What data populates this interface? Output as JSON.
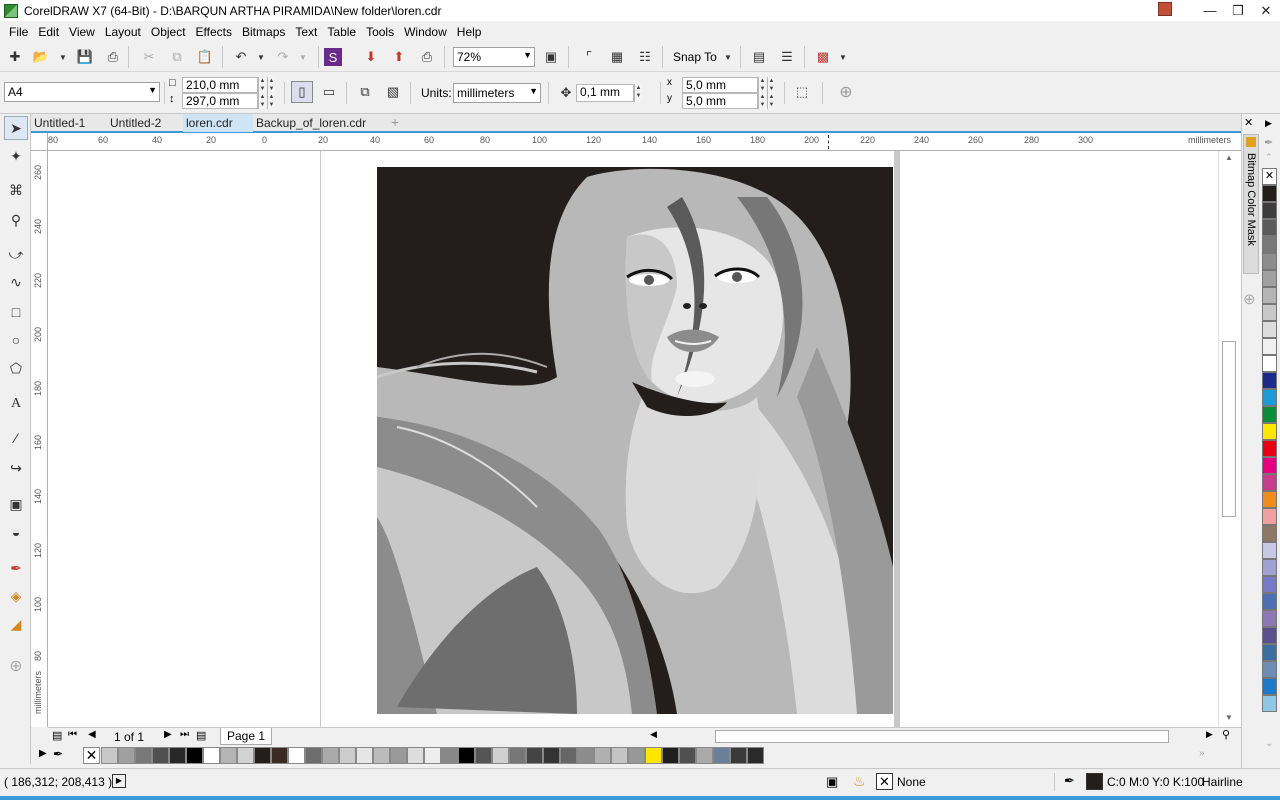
{
  "window": {
    "title": "CorelDRAW X7 (64-Bit) - D:\\BARQUN ARTHA PIRAMIDA\\New folder\\loren.cdr"
  },
  "menu": [
    "File",
    "Edit",
    "View",
    "Layout",
    "Object",
    "Effects",
    "Bitmaps",
    "Text",
    "Table",
    "Tools",
    "Window",
    "Help"
  ],
  "toolbar": {
    "zoom": "72%",
    "snap_to": "Snap To"
  },
  "property_bar": {
    "page_size": "A4",
    "width": "210,0 mm",
    "height": "297,0 mm",
    "units_label": "Units:",
    "units": "millimeters",
    "nudge": "0,1 mm",
    "dup_x": "5,0 mm",
    "dup_y": "5,0 mm"
  },
  "tabs": [
    "Untitled-1",
    "Untitled-2",
    "loren.cdr",
    "Backup_of_loren.cdr"
  ],
  "rulers": {
    "h_ticks": [
      "80",
      "60",
      "40",
      "20",
      "0",
      "20",
      "40",
      "60",
      "80",
      "100",
      "120",
      "140",
      "160",
      "180",
      "200",
      "220",
      "240",
      "260",
      "280",
      "300"
    ],
    "h_unit": "millimeters",
    "v_ticks": [
      "260",
      "240",
      "220",
      "200",
      "180",
      "160",
      "140",
      "120",
      "100",
      "80"
    ],
    "v_unit": "millimeters"
  },
  "page_nav": {
    "count": "1 of 1",
    "page_tab": "Page 1"
  },
  "docker": {
    "title": "Bitmap Color Mask"
  },
  "status": {
    "coords": "( 186,312; 208,413 )",
    "fill": "None",
    "outline_color": "C:0 M:0 Y:0 K:100",
    "outline_width": "Hairline"
  },
  "colors": {
    "accent": "#3c9ad8",
    "art_bg": "#231e1b"
  },
  "palette_bottom": [
    "#c8c8c8",
    "#a0a0a0",
    "#787878",
    "#505050",
    "#282828",
    "#000000",
    "#ffffff",
    "#b4b4b4",
    "#d2d2d2",
    "#231e1b",
    "#3c2a24",
    "#ffffff",
    "#6e6e6e",
    "#aaaaaa",
    "#cccccc",
    "#e6e6e6",
    "#bbbbbb",
    "#999999",
    "#dddddd",
    "#eeeeee",
    "#888888",
    "#000000",
    "#555555",
    "#d0d0d0",
    "#777777",
    "#444444",
    "#333333",
    "#666666",
    "#8c8c8c",
    "#b0b0b0",
    "#c4c4c4",
    "#989898",
    "#ffe600",
    "#1e1e1e",
    "#505050",
    "#aaaaaa",
    "#6a7f9a",
    "#3a3a3a",
    "#2a2a2a"
  ],
  "palette_right": [
    "#231e1b",
    "#3c3c3c",
    "#5a5a5a",
    "#787878",
    "#8c8c8c",
    "#a0a0a0",
    "#b4b4b4",
    "#c8c8c8",
    "#dcdcdc",
    "#f0f0f0",
    "#ffffff",
    "#1c2a8c",
    "#1c9ad8",
    "#0a8c3c",
    "#ffe600",
    "#e60012",
    "#e6007e",
    "#c83c8c",
    "#f08c1e",
    "#f0a0a0",
    "#8c7864",
    "#c8c8e6",
    "#a0a0d2",
    "#7878c8",
    "#506eb4",
    "#8c78b4",
    "#5a508c",
    "#3c6ea0",
    "#6e8cb4",
    "#1c78c8",
    "#8cc8e6"
  ]
}
